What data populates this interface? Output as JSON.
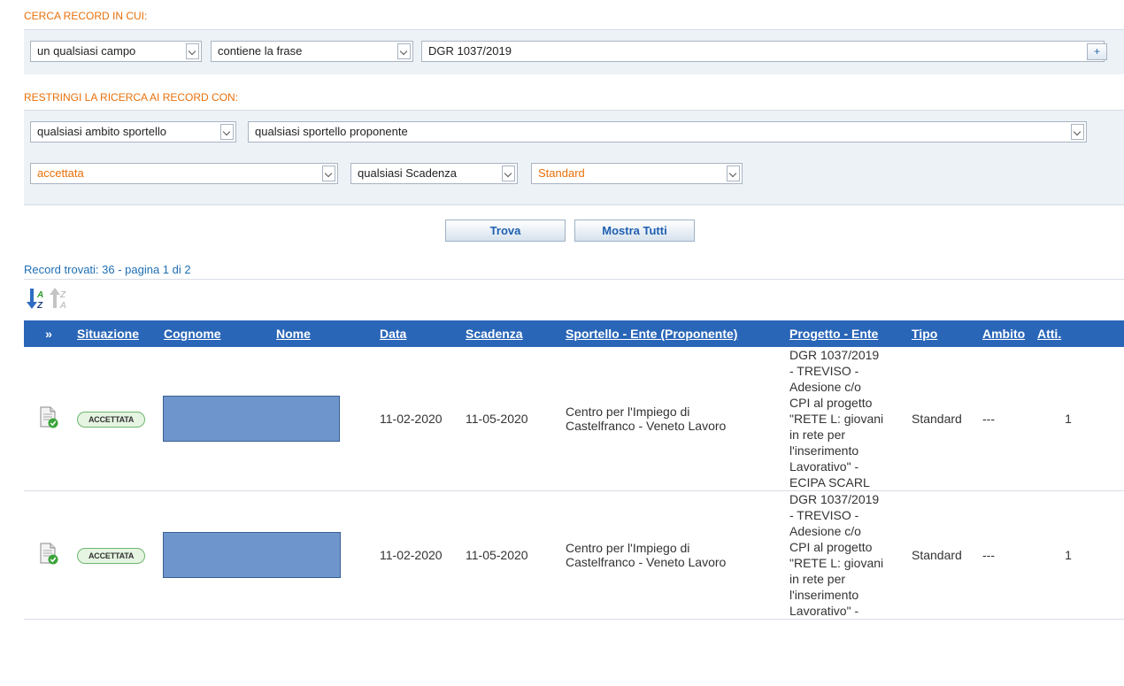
{
  "search": {
    "title": "CERCA RECORD IN CUI:",
    "field_select": "un qualsiasi campo",
    "operator_select": "contiene la frase",
    "query": "DGR 1037/2019",
    "add_label": "+"
  },
  "filters": {
    "title": "RESTRINGI LA RICERCA AI RECORD CON:",
    "ambito": "qualsiasi ambito sportello",
    "sportello": "qualsiasi sportello proponente",
    "situazione": "accettata",
    "scadenza": "qualsiasi Scadenza",
    "tipo": "Standard"
  },
  "actions": {
    "find": "Trova",
    "show_all": "Mostra Tutti"
  },
  "results": {
    "summary": "Record trovati: 36 - pagina 1 di 2",
    "columns": [
      "»",
      "Situazione",
      "Cognome",
      "Nome",
      "Data",
      "Scadenza",
      "Sportello - Ente (Proponente)",
      "Progetto - Ente",
      "Tipo",
      "Ambito",
      "Atti."
    ],
    "rows": [
      {
        "status": "ACCETTATA",
        "data": "11-02-2020",
        "scadenza": "11-05-2020",
        "sportello_1": "Centro per l'Impiego di",
        "sportello_2": "Castelfranco - Veneto Lavoro",
        "progetto": [
          "DGR 1037/2019",
          "- TREVISO -",
          "Adesione c/o",
          "CPI al progetto",
          "\"RETE L: giovani",
          "in rete per",
          "l'inserimento",
          "Lavorativo\" -",
          "ECIPA SCARL"
        ],
        "tipo": "Standard",
        "ambito": "---",
        "atti": "1"
      },
      {
        "status": "ACCETTATA",
        "data": "11-02-2020",
        "scadenza": "11-05-2020",
        "sportello_1": "Centro per l'Impiego di",
        "sportello_2": "Castelfranco - Veneto Lavoro",
        "progetto": [
          "DGR 1037/2019",
          "- TREVISO -",
          "Adesione c/o",
          "CPI al progetto",
          "\"RETE L: giovani",
          "in rete per",
          "l'inserimento",
          "Lavorativo\" -"
        ],
        "tipo": "Standard",
        "ambito": "---",
        "atti": "1"
      }
    ]
  },
  "colors": {
    "accent": "#e8700a",
    "header_blue": "#2a66b8",
    "link_blue": "#1f6fb4",
    "redaction": "#6f96cc"
  },
  "icons": {
    "sort_asc": "sort-az-icon",
    "sort_desc": "sort-za-icon",
    "record": "document-check-icon"
  }
}
